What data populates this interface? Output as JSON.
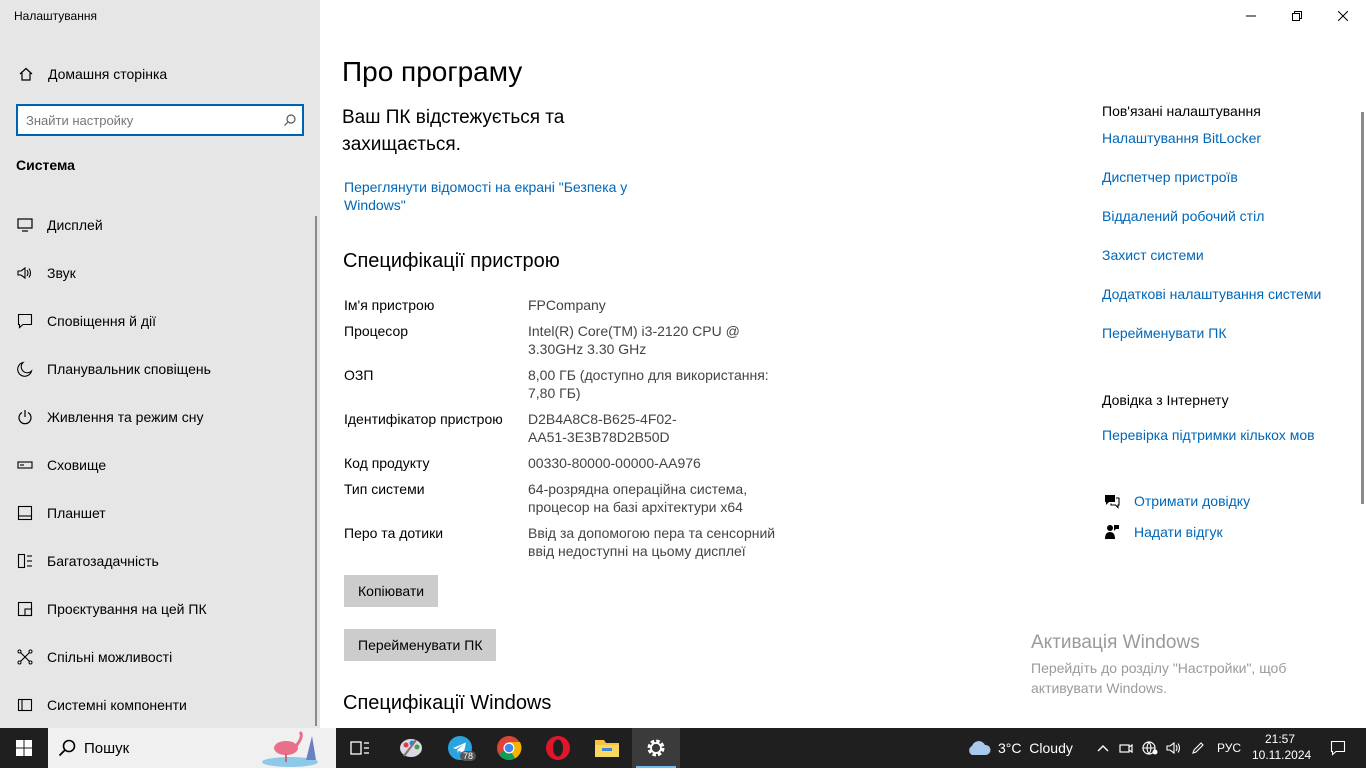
{
  "app": {
    "title": "Налаштування",
    "home_label": "Домашня сторінка",
    "search_placeholder": "Знайти настройку",
    "section_title": "Система"
  },
  "sidebar": {
    "items": [
      {
        "label": "Дисплей",
        "icon": "display-icon"
      },
      {
        "label": "Звук",
        "icon": "sound-icon"
      },
      {
        "label": "Сповіщення й дії",
        "icon": "notifications-icon"
      },
      {
        "label": "Планувальник сповіщень",
        "icon": "moon-icon"
      },
      {
        "label": "Живлення та режим сну",
        "icon": "power-icon"
      },
      {
        "label": "Сховище",
        "icon": "storage-icon"
      },
      {
        "label": "Планшет",
        "icon": "tablet-icon"
      },
      {
        "label": "Багатозадачність",
        "icon": "multitasking-icon"
      },
      {
        "label": "Проєктування на цей ПК",
        "icon": "projecting-icon"
      },
      {
        "label": "Спільні можливості",
        "icon": "shared-experiences-icon"
      },
      {
        "label": "Системні компоненти",
        "icon": "system-components-icon"
      }
    ]
  },
  "main": {
    "title": "Про програму",
    "protection_text": "Ваш ПК відстежується та захищається.",
    "security_link": "Переглянути відомості на екрані \"Безпека у Windows\"",
    "device_specs_title": "Специфікації пристрою",
    "specs": [
      {
        "key": "Ім'я пристрою",
        "value": "FPCompany"
      },
      {
        "key": "Процесор",
        "value": "Intel(R) Core(TM) i3-2120 CPU @ 3.30GHz   3.30 GHz"
      },
      {
        "key": "ОЗП",
        "value": "8,00 ГБ (доступно для використання: 7,80 ГБ)"
      },
      {
        "key": "Ідентифікатор пристрою",
        "value": "D2B4A8C8-B625-4F02-AA51-3E3B78D2B50D"
      },
      {
        "key": "Код продукту",
        "value": "00330-80000-00000-AA976"
      },
      {
        "key": "Тип системи",
        "value": "64-розрядна операційна система, процесор на базі архітектури x64"
      },
      {
        "key": "Перо та дотики",
        "value": "Ввід за допомогою пера та сенсорний ввід недоступні на цьому дисплеї"
      }
    ],
    "copy_button": "Копіювати",
    "rename_button": "Перейменувати ПК",
    "windows_specs_title": "Специфікації Windows"
  },
  "related": {
    "title": "Пов'язані налаштування",
    "links": [
      "Налаштування BitLocker",
      "Диспетчер пристроїв",
      "Віддалений робочий стіл",
      "Захист системи",
      "Додаткові налаштування системи",
      "Перейменувати ПК"
    ],
    "web_help_title": "Довідка з Інтернету",
    "web_help_link": "Перевірка підтримки кількох мов",
    "get_help": "Отримати довідку",
    "feedback": "Надати відгук"
  },
  "activation": {
    "title": "Активація Windows",
    "subtitle": "Перейдіть до розділу \"Настройки\", щоб активувати Windows."
  },
  "taskbar": {
    "search_label": "Пошук",
    "telegram_badge": "78",
    "weather": "3°C  Cloudy",
    "language": "РУС",
    "time": "21:57",
    "date": "10.11.2024"
  }
}
